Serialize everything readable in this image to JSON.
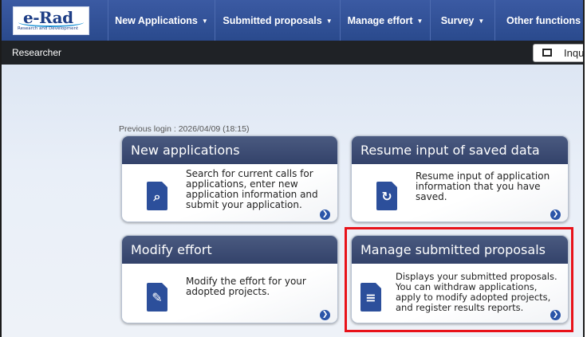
{
  "logo": {
    "text": "e-Rad",
    "subtitle": "Research and Development"
  },
  "nav": [
    {
      "label": "New Applications"
    },
    {
      "label": "Submitted proposals"
    },
    {
      "label": "Manage effort"
    },
    {
      "label": "Survey"
    },
    {
      "label": "Other functions"
    }
  ],
  "subbar": {
    "role": "Researcher",
    "inquiry_label": "Inqu"
  },
  "previous_login": "Previous login : 2026/04/09 (18:15)",
  "cards": [
    {
      "title": "New applications",
      "description": "Search for current calls for applications, enter new application information and submit your application.",
      "icon": "search-document-icon"
    },
    {
      "title": "Resume input of saved data",
      "description": "Resume input of application information that you have saved.",
      "icon": "resume-document-icon"
    },
    {
      "title": "Modify effort",
      "description": "Modify the effort for your adopted projects.",
      "icon": "edit-document-icon"
    },
    {
      "title": "Manage submitted proposals",
      "description": "Displays your submitted proposals. You can withdraw applications, apply to modify adopted projects, and register results reports.",
      "icon": "list-document-icon"
    }
  ],
  "colors": {
    "nav_bg": "#2f4e95",
    "card_header": "#3d4b72",
    "highlight": "#e8121a",
    "go_button": "#2b55a8"
  }
}
